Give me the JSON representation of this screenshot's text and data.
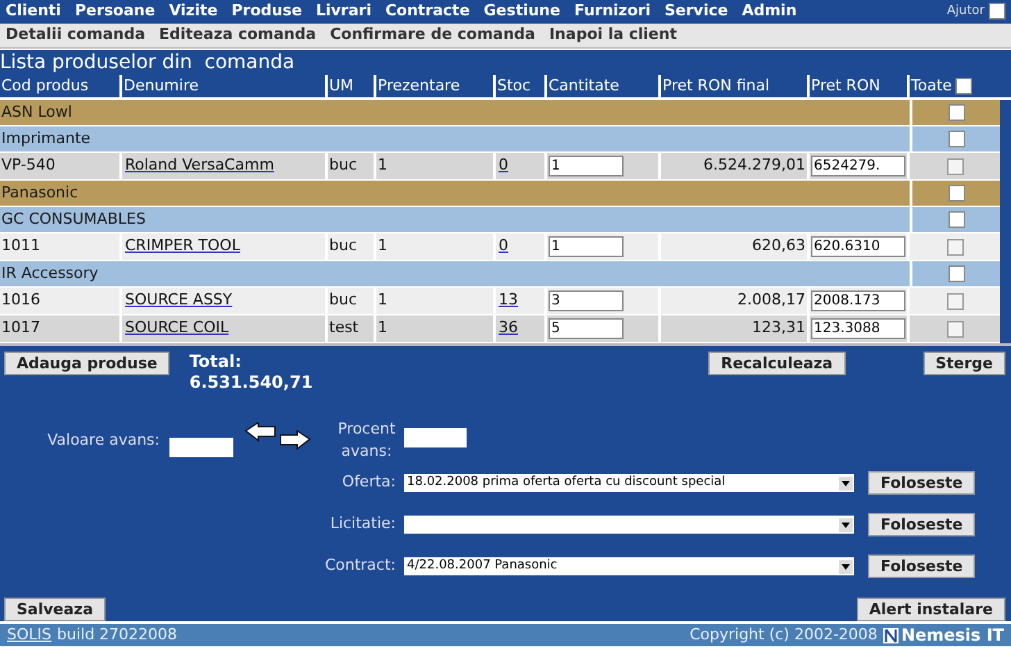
{
  "menu": [
    "Clienti",
    "Persoane",
    "Vizite",
    "Produse",
    "Livrari",
    "Contracte",
    "Gestiune",
    "Furnizori",
    "Service",
    "Admin"
  ],
  "help": {
    "label": "Ajutor",
    "checked": false
  },
  "submenu": [
    "Detalii comanda",
    "Editeaza comanda",
    "Confirmare de comanda",
    "Inapoi la client"
  ],
  "title": "Lista produselor din  comanda",
  "columns": [
    "Cod produs",
    "Denumire",
    "UM",
    "Prezentare",
    "Stoc",
    "Cantitate",
    "Pret RON final",
    "Pret RON",
    "Toate"
  ],
  "select_all": false,
  "rows": [
    {
      "kind": "supplier",
      "label": "ASN Lowl",
      "checked": false
    },
    {
      "kind": "category",
      "label": "Imprimante",
      "checked": false
    },
    {
      "kind": "product",
      "code": "VP-540",
      "name": "Roland VersaCamm",
      "um": "buc",
      "prezentare": "1",
      "stoc": "0",
      "cantitate": "1",
      "final": "6.524.279,01",
      "pret": "6524279.",
      "checked": false,
      "shaded": true
    },
    {
      "kind": "supplier",
      "label": "Panasonic",
      "checked": false
    },
    {
      "kind": "category",
      "label": "GC CONSUMABLES",
      "checked": false
    },
    {
      "kind": "product",
      "code": "1011",
      "name": "CRIMPER TOOL",
      "um": "buc",
      "prezentare": "1",
      "stoc": "0",
      "cantitate": "1",
      "final": "620,63",
      "pret": "620.6310",
      "checked": false,
      "shaded": false
    },
    {
      "kind": "category",
      "label": "IR Accessory",
      "checked": false
    },
    {
      "kind": "product",
      "code": "1016",
      "name": "SOURCE ASSY",
      "um": "buc",
      "prezentare": "1",
      "stoc": "13",
      "cantitate": "3",
      "final": "2.008,17",
      "pret": "2008.173",
      "checked": false,
      "shaded": false
    },
    {
      "kind": "product",
      "code": "1017",
      "name": "SOURCE COIL",
      "um": "test",
      "prezentare": "1",
      "stoc": "36",
      "cantitate": "5",
      "final": "123,31",
      "pret": "123.3088",
      "checked": false,
      "shaded": true
    }
  ],
  "add_button": "Adauga produse",
  "total_label": "Total:",
  "total_value": "6.531.540,71",
  "recalc_button": "Recalculeaza",
  "delete_button": "Sterge",
  "advance_value_label": "Valoare avans:",
  "advance_percent_label": "Procent avans:",
  "selects": [
    {
      "label": "Oferta:",
      "value": "18.02.2008 prima oferta oferta cu discount special",
      "button": "Foloseste"
    },
    {
      "label": "Licitatie:",
      "button": "Foloseste"
    },
    {
      "label": "Contract:",
      "value": "4/22.08.2007 Panasonic",
      "button": "Foloseste"
    }
  ],
  "save_button": "Salveaza",
  "alert_button": "Alert instalare",
  "footer": {
    "link": "SOLIS",
    "build": "build 27022008",
    "copyright": "Copyright (c) 2002-2008",
    "brand": "Nemesis IT"
  }
}
